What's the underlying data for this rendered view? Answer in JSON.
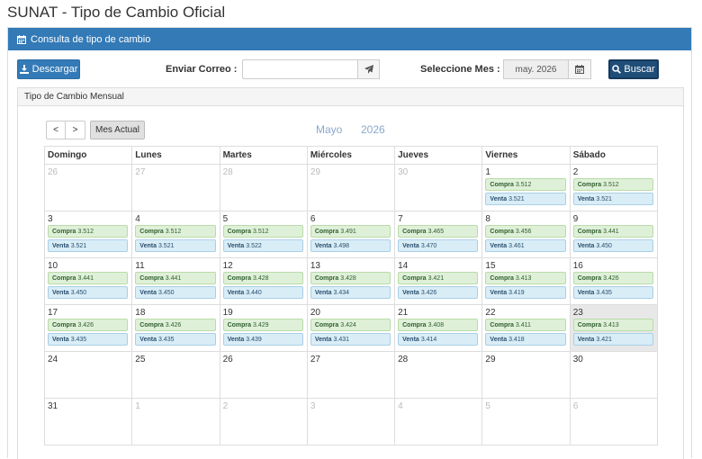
{
  "page": {
    "title": "SUNAT - Tipo de Cambio Oficial"
  },
  "panel": {
    "title": "Consulta de tipo de cambio",
    "icon": "calendar-icon"
  },
  "toolbar": {
    "descargar_label": "Descargar",
    "enviar_label": "Enviar Correo :",
    "email_value": "",
    "seleccione_label": "Seleccione Mes :",
    "month_value": "may. 2026",
    "buscar_label": "Buscar"
  },
  "subpanel": {
    "title": "Tipo de Cambio Mensual"
  },
  "calendar": {
    "prev_label": "<",
    "next_label": ">",
    "today_label": "Mes Actual",
    "month": "Mayo",
    "year": "2026",
    "weekdays": [
      "Domingo",
      "Lunes",
      "Martes",
      "Miércoles",
      "Jueves",
      "Viernes",
      "Sábado"
    ],
    "compra_label": "Compra",
    "venta_label": "Venta",
    "highlight_color": "#e8e8e8",
    "weeks": [
      [
        {
          "d": "26",
          "o": true
        },
        {
          "d": "27",
          "o": true
        },
        {
          "d": "28",
          "o": true
        },
        {
          "d": "29",
          "o": true
        },
        {
          "d": "30",
          "o": true
        },
        {
          "d": "1",
          "c": "3.512",
          "v": "3.521"
        },
        {
          "d": "2",
          "c": "3.512",
          "v": "3.521"
        }
      ],
      [
        {
          "d": "3",
          "c": "3.512",
          "v": "3.521"
        },
        {
          "d": "4",
          "c": "3.512",
          "v": "3.521"
        },
        {
          "d": "5",
          "c": "3.512",
          "v": "3.522"
        },
        {
          "d": "6",
          "c": "3.491",
          "v": "3.498"
        },
        {
          "d": "7",
          "c": "3.465",
          "v": "3.470"
        },
        {
          "d": "8",
          "c": "3.456",
          "v": "3.461"
        },
        {
          "d": "9",
          "c": "3.441",
          "v": "3.450"
        }
      ],
      [
        {
          "d": "10",
          "c": "3.441",
          "v": "3.450"
        },
        {
          "d": "11",
          "c": "3.441",
          "v": "3.450"
        },
        {
          "d": "12",
          "c": "3.428",
          "v": "3.440"
        },
        {
          "d": "13",
          "c": "3.428",
          "v": "3.434"
        },
        {
          "d": "14",
          "c": "3.421",
          "v": "3.426"
        },
        {
          "d": "15",
          "c": "3.413",
          "v": "3.419"
        },
        {
          "d": "16",
          "c": "3.426",
          "v": "3.435"
        }
      ],
      [
        {
          "d": "17",
          "c": "3.426",
          "v": "3.435"
        },
        {
          "d": "18",
          "c": "3.426",
          "v": "3.435"
        },
        {
          "d": "19",
          "c": "3.429",
          "v": "3.439"
        },
        {
          "d": "20",
          "c": "3.424",
          "v": "3.431"
        },
        {
          "d": "21",
          "c": "3.408",
          "v": "3.414"
        },
        {
          "d": "22",
          "c": "3.411",
          "v": "3.418"
        },
        {
          "d": "23",
          "c": "3.413",
          "v": "3.421",
          "today": true
        }
      ],
      [
        {
          "d": "24"
        },
        {
          "d": "25"
        },
        {
          "d": "26"
        },
        {
          "d": "27"
        },
        {
          "d": "28"
        },
        {
          "d": "29"
        },
        {
          "d": "30"
        }
      ],
      [
        {
          "d": "31"
        },
        {
          "d": "1",
          "o": true
        },
        {
          "d": "2",
          "o": true
        },
        {
          "d": "3",
          "o": true
        },
        {
          "d": "4",
          "o": true
        },
        {
          "d": "5",
          "o": true
        },
        {
          "d": "6",
          "o": true
        }
      ]
    ]
  }
}
